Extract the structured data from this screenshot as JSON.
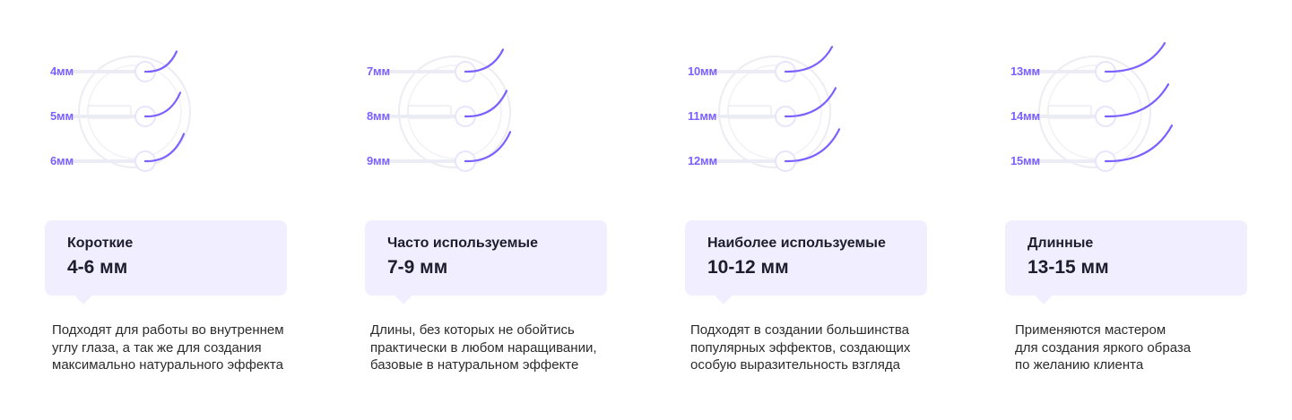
{
  "accent": "#7b61ff",
  "card_bg": "#f1efff",
  "groups": [
    {
      "lengths": [
        "4мм",
        "5мм",
        "6мм"
      ],
      "title": "Короткие",
      "range": "4-6 мм",
      "description": [
        "Подходят для работы во внутреннем",
        "углу глаза, а так же для создания",
        "максимально натурального эффекта"
      ]
    },
    {
      "lengths": [
        "7мм",
        "8мм",
        "9мм"
      ],
      "title": "Часто используемые",
      "range": "7-9 мм",
      "description": [
        "Длины, без которых не обойтись",
        "практически в любом наращивании,",
        "базовые в натуральном эффекте"
      ]
    },
    {
      "lengths": [
        "10мм",
        "11мм",
        "12мм"
      ],
      "title": "Наиболее используемые",
      "range": "10-12 мм",
      "description": [
        "Подходят в создании большинства",
        "популярных эффектов, создающих",
        "особую выразительность взгляда"
      ]
    },
    {
      "lengths": [
        "13мм",
        "14мм",
        "15мм"
      ],
      "title": "Длинные",
      "range": "13-15 мм",
      "description": [
        "Применяются мастером",
        "для создания яркого образа",
        "по желанию клиента"
      ]
    }
  ]
}
